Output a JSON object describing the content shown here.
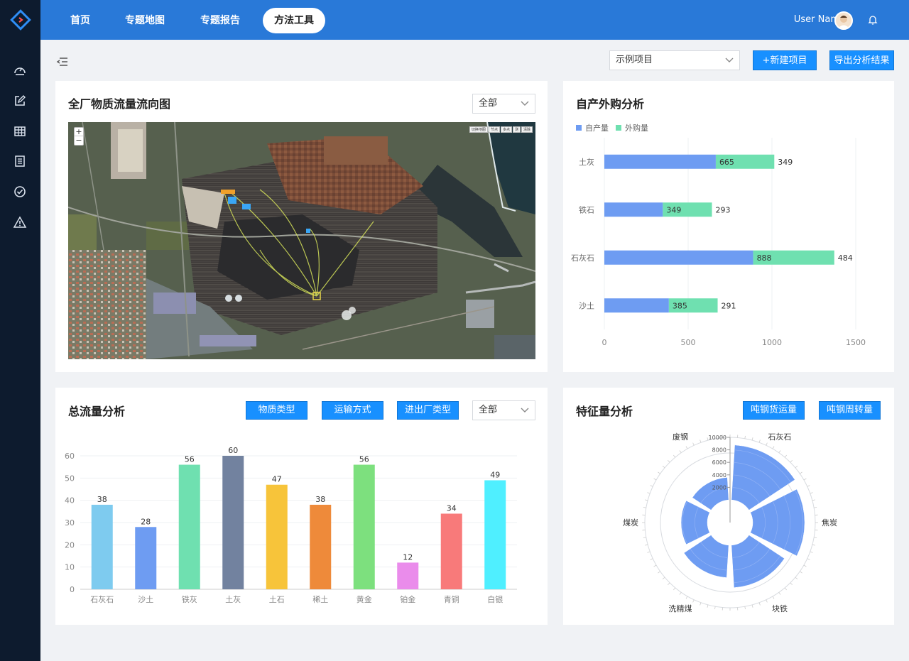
{
  "nav": {
    "items": [
      "首页",
      "专题地图",
      "专题报告",
      "方法工具"
    ],
    "active_index": 3,
    "user_name": "User Name"
  },
  "sidebar": {
    "icons": [
      "dashboard-icon",
      "edit-icon",
      "table-icon",
      "list-icon",
      "check-circle-icon",
      "warning-icon"
    ]
  },
  "toolbar": {
    "project_select": "示例项目",
    "new_project": "+新建项目",
    "export": "导出分析结果"
  },
  "flow_map": {
    "title": "全厂物质流量流向图",
    "filter": "全部",
    "map_controls": [
      "切换地图",
      "节点",
      "多点",
      "测",
      "清除"
    ]
  },
  "self_vs_purchase": {
    "title": "自产外购分析",
    "chart_data": {
      "type": "bar",
      "orientation": "horizontal",
      "stacked": true,
      "categories": [
        "土灰",
        "铁石",
        "石灰石",
        "沙土"
      ],
      "series": [
        {
          "name": "自产量",
          "values": [
            665,
            349,
            888,
            385
          ],
          "color": "#6e9cf2"
        },
        {
          "name": "外购量",
          "values": [
            349,
            293,
            484,
            291
          ],
          "color": "#6fe0b0"
        }
      ],
      "xlim": [
        0,
        1500
      ],
      "xticks": [
        0,
        500,
        1000,
        1500
      ],
      "legend": "top-left"
    }
  },
  "total_flow": {
    "title": "总流量分析",
    "buttons": [
      "物质类型",
      "运输方式",
      "进出厂类型"
    ],
    "filter": "全部",
    "chart_data": {
      "type": "bar",
      "categories": [
        "石灰石",
        "沙土",
        "铁灰",
        "土灰",
        "土石",
        "稀土",
        "黄金",
        "铂金",
        "青铜",
        "白银"
      ],
      "values": [
        38,
        28,
        56,
        60,
        47,
        38,
        56,
        12,
        34,
        49
      ],
      "colors": [
        "#7ecbef",
        "#6e9cf2",
        "#6fe0b0",
        "#72829f",
        "#f7c43a",
        "#ee8a3a",
        "#7de07e",
        "#ea8ceb",
        "#f87a7a",
        "#4fefff"
      ],
      "ylim": [
        0,
        60
      ],
      "yticks": [
        0,
        10,
        20,
        30,
        40,
        50,
        60
      ]
    }
  },
  "feature_analysis": {
    "title": "特征量分析",
    "buttons": [
      "吨钢货运量",
      "吨钢周转量"
    ],
    "chart_data": {
      "type": "bar",
      "coordinate": "polar",
      "categories": [
        "石灰石",
        "焦炭",
        "块铁",
        "洗精煤",
        "煤炭",
        "废钢"
      ],
      "values": [
        8800,
        8300,
        6800,
        5200,
        4200,
        3600
      ],
      "radial_ticks": [
        2000,
        4000,
        6000,
        8000,
        10000
      ],
      "rmax": 10000,
      "color": "#6e9cf2"
    }
  }
}
